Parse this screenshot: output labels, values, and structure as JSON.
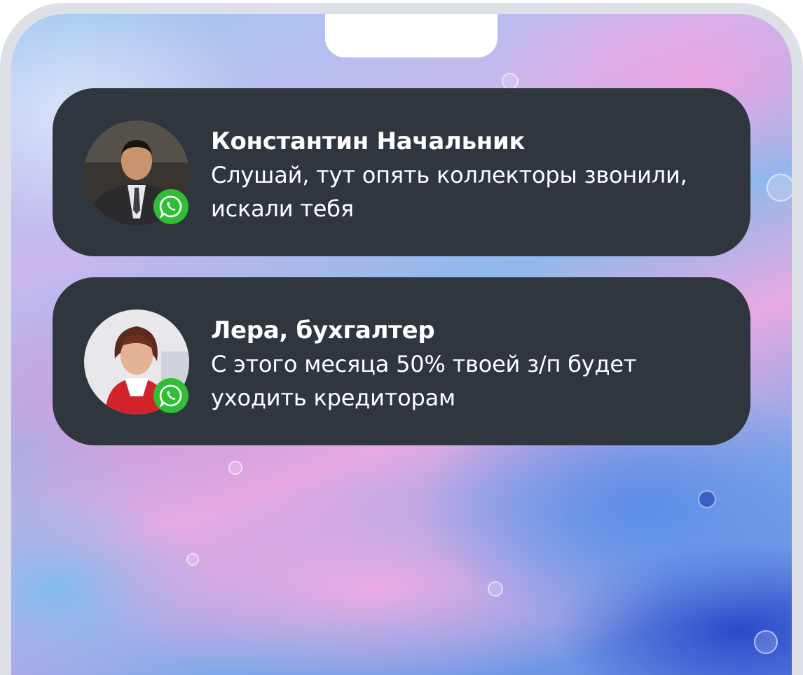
{
  "notifications": [
    {
      "sender": "Константин Начальник",
      "message_line1": "Слушай, тут опять коллекторы звонили,",
      "message_line2": "искали тебя",
      "app_icon": "whatsapp-icon"
    },
    {
      "sender": "Лера, бухгалтер",
      "message_line1": "С этого месяца 50% твоей з/п будет",
      "message_line2": "уходить кредиторам",
      "app_icon": "whatsapp-icon"
    }
  ],
  "colors": {
    "card_background": "#2f363e",
    "whatsapp_green": "#2fbe35",
    "phone_frame": "#dde0e7"
  }
}
